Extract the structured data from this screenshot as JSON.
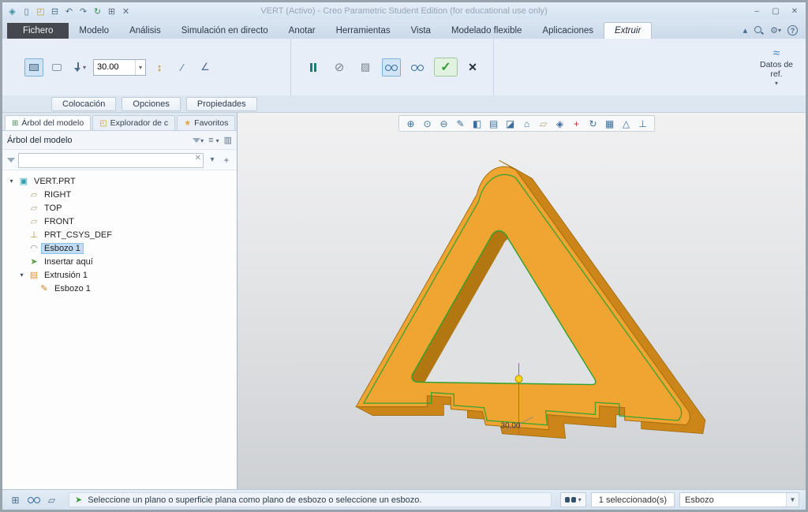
{
  "titlebar": {
    "title": "VERT (Activo) - Creo Parametric Student Edition (for educational use only)",
    "quick_access_icons": [
      "new-file-icon",
      "open-file-icon",
      "save-icon",
      "undo-icon",
      "redo-icon",
      "regenerate-icon",
      "windows-icon",
      "close-window-icon"
    ],
    "window_controls": [
      {
        "name": "minimize",
        "glyph": "–"
      },
      {
        "name": "maximize",
        "glyph": "▢"
      },
      {
        "name": "close",
        "glyph": "✕"
      }
    ]
  },
  "ribbon_tabs": [
    {
      "label": "Fichero",
      "style": "dark"
    },
    {
      "label": "Modelo"
    },
    {
      "label": "Análisis"
    },
    {
      "label": "Simulación en directo"
    },
    {
      "label": "Anotar"
    },
    {
      "label": "Herramientas"
    },
    {
      "label": "Vista"
    },
    {
      "label": "Modelado flexible"
    },
    {
      "label": "Aplicaciones"
    },
    {
      "label": "Extruir",
      "style": "active"
    }
  ],
  "tabrow_right_icons": [
    "collapse-ribbon-icon",
    "search-icon",
    "options-gear-icon",
    "help-icon"
  ],
  "dashboard": {
    "depth_value": "30.00",
    "reference_data_label": "Datos de ref.",
    "tabs": [
      "Colocación",
      "Opciones",
      "Propiedades"
    ]
  },
  "left_panel": {
    "tabs": [
      {
        "label": "Árbol del modelo",
        "icon": "model-tree-icon",
        "active": true
      },
      {
        "label": "Explorador de c",
        "icon": "folder-browser-icon",
        "active": false
      },
      {
        "label": "Favoritos",
        "icon": "favorites-star-icon",
        "active": false
      }
    ],
    "header_title": "Árbol del modelo",
    "search_value": "",
    "tree": [
      {
        "label": "VERT.PRT",
        "icon": "part-icon",
        "level": 0,
        "expanded": true
      },
      {
        "label": "RIGHT",
        "icon": "datum-plane-icon",
        "level": 1
      },
      {
        "label": "TOP",
        "icon": "datum-plane-icon",
        "level": 1
      },
      {
        "label": "FRONT",
        "icon": "datum-plane-icon",
        "level": 1
      },
      {
        "label": "PRT_CSYS_DEF",
        "icon": "csys-icon",
        "level": 1
      },
      {
        "label": "Esbozo 1",
        "icon": "sketch-icon",
        "level": 1,
        "selected": true
      },
      {
        "label": "Insertar aquí",
        "icon": "insert-here-icon",
        "level": 1
      },
      {
        "label": "Extrusión 1",
        "icon": "extrude-icon",
        "level": 1,
        "expanded": true
      },
      {
        "label": "Esbozo 1",
        "icon": "sketch-feature-icon",
        "level": 2
      }
    ]
  },
  "graphics": {
    "toolbar_icons": [
      "zoom-in-icon",
      "zoom-fit-icon",
      "zoom-out-icon",
      "repaint-icon",
      "shaded-view-icon",
      "display-style-icon",
      "section-view-icon",
      "saved-views-icon",
      "datum-display-icon",
      "annotation-display-icon",
      "spin-center-icon",
      "view-rotate-icon",
      "view-manager-icon",
      "perspective-icon",
      "analysis-display-icon"
    ],
    "dimension_label": "30.00",
    "part_color": "#f0a432",
    "part_side_color": "#cc8519",
    "sketch_color": "#2da12d"
  },
  "status_bar": {
    "left_icons": [
      "model-tree-toggle-icon",
      "preview-glasses-icon",
      "plane-display-icon"
    ],
    "message": "Seleccione un plano o superficie plana como plano de esbozo o seleccione un esbozo.",
    "selection_count": "1 seleccionado(s)",
    "filter_value": "Esbozo"
  }
}
